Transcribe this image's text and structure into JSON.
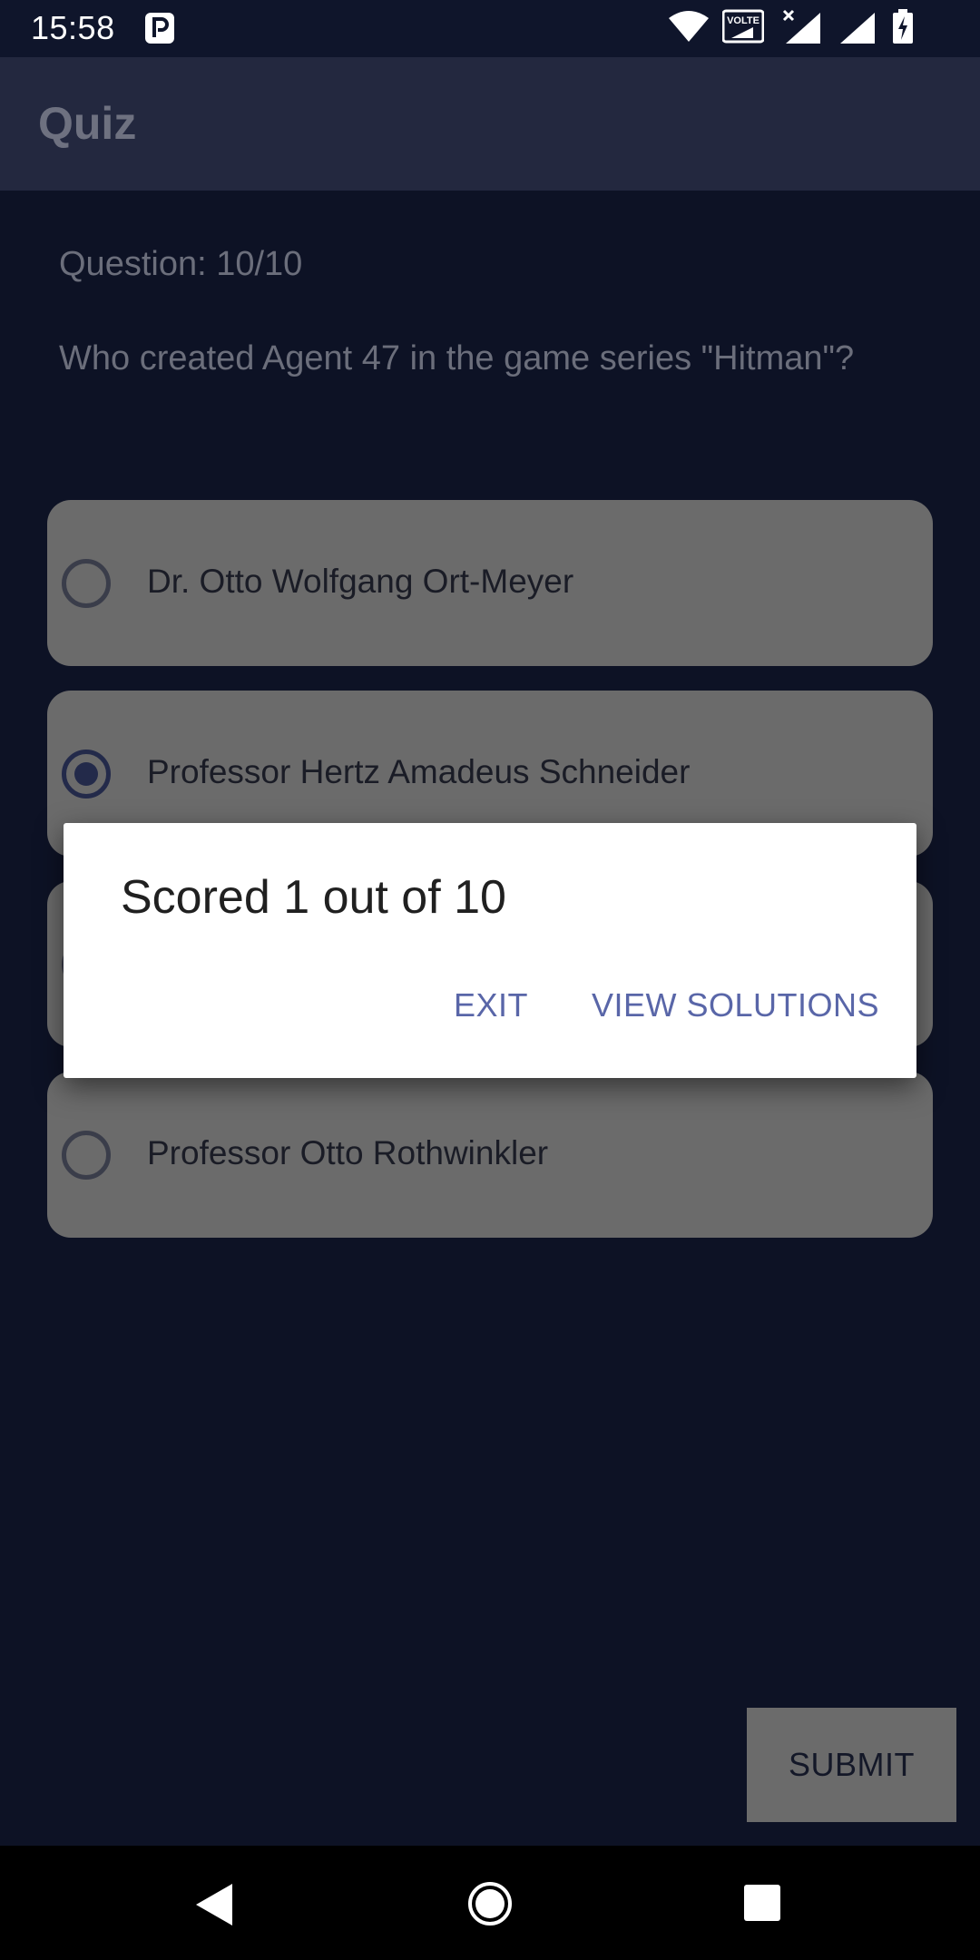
{
  "status_bar": {
    "time": "15:58",
    "icons": [
      "parking-icon",
      "wifi-icon",
      "volte-icon",
      "signal-icon",
      "signal-icon",
      "battery-charging-icon"
    ],
    "volte_text": "VOLTE"
  },
  "app_bar": {
    "title": "Quiz"
  },
  "quiz": {
    "counter": "Question: 10/10",
    "question": "Who created Agent 47 in the game series \"Hitman\"?",
    "options": [
      {
        "label": "Dr. Otto Wolfgang Ort-Meyer",
        "selected": false
      },
      {
        "label": "Professor Hertz Amadeus Schneider",
        "selected": true
      },
      {
        "label": "",
        "selected": false
      },
      {
        "label": "Professor Otto Rothwinkler",
        "selected": false
      }
    ],
    "submit_label": "SUBMIT"
  },
  "dialog": {
    "title": "Scored 1 out of 10",
    "exit_label": "EXIT",
    "view_solutions_label": "VIEW SOLUTIONS"
  },
  "colors": {
    "background": "#0d1225",
    "app_bar": "#23283f",
    "option_card": "#6b6b6b",
    "dialog_accent": "#5966a8"
  }
}
